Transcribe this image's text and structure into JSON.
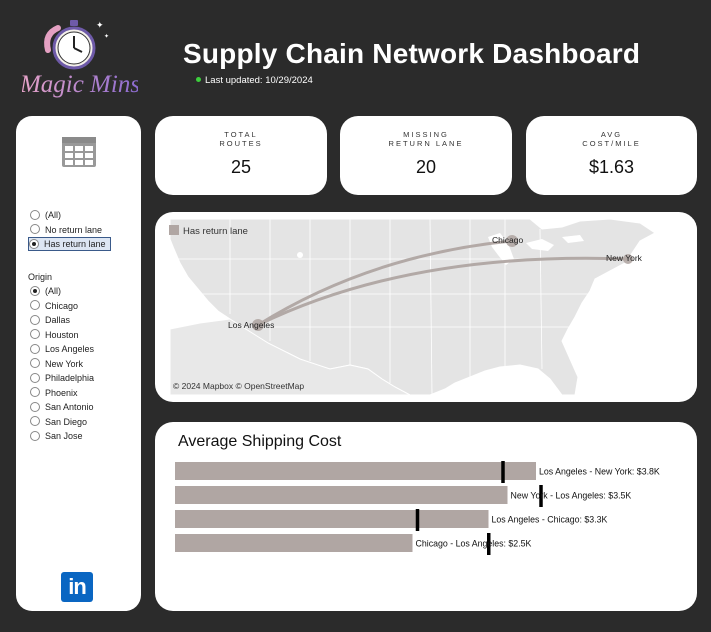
{
  "brand": {
    "logo_text": "Magic Mins",
    "icon": "clock-logo-icon"
  },
  "header": {
    "title": "Supply Chain Network Dashboard",
    "last_updated": "Last updated: 10/29/2024",
    "status_color": "#3ccf3c"
  },
  "filters": {
    "table_icon": "table-icon",
    "return_lane_options": [
      {
        "label": "(All)",
        "selected": false
      },
      {
        "label": "No return lane",
        "selected": false
      },
      {
        "label": "Has return lane",
        "selected": true
      }
    ],
    "origin_label": "Origin",
    "origin_options": [
      {
        "label": "(All)",
        "selected": true
      },
      {
        "label": "Chicago",
        "selected": false
      },
      {
        "label": "Dallas",
        "selected": false
      },
      {
        "label": "Houston",
        "selected": false
      },
      {
        "label": "Los Angeles",
        "selected": false
      },
      {
        "label": "New York",
        "selected": false
      },
      {
        "label": "Philadelphia",
        "selected": false
      },
      {
        "label": "Phoenix",
        "selected": false
      },
      {
        "label": "San Antonio",
        "selected": false
      },
      {
        "label": "San Diego",
        "selected": false
      },
      {
        "label": "San Jose",
        "selected": false
      }
    ],
    "linkedin_label": "in"
  },
  "kpis": [
    {
      "label_line1": "TOTAL",
      "label_line2": "ROUTES",
      "value": "25"
    },
    {
      "label_line1": "MISSING",
      "label_line2": "RETURN LANE",
      "value": "20"
    },
    {
      "label_line1": "AVG",
      "label_line2": "COST/MILE",
      "value": "$1.63"
    }
  ],
  "map": {
    "legend_label": "Has return lane",
    "legend_color": "#b0a6a3",
    "cities": [
      "Chicago",
      "New York",
      "Los Angeles"
    ],
    "attribution": "© 2024 Mapbox  © OpenStreetMap"
  },
  "chart_data": {
    "type": "bar",
    "title": "Average Shipping Cost",
    "categories": [
      "Los Angeles  -  New York: $3.8K",
      "New York  -  Los Angeles: $3.5K",
      "Los Angeles  -  Chicago: $3.3K",
      "Chicago  -  Los Angeles: $2.5K"
    ],
    "values": [
      3.8,
      3.5,
      3.3,
      2.5
    ],
    "reference_values": [
      3.45,
      3.85,
      2.55,
      3.3
    ],
    "bar_color": "#b0a6a3",
    "reference_color": "#000000",
    "xlim": [
      0,
      4.0
    ]
  }
}
